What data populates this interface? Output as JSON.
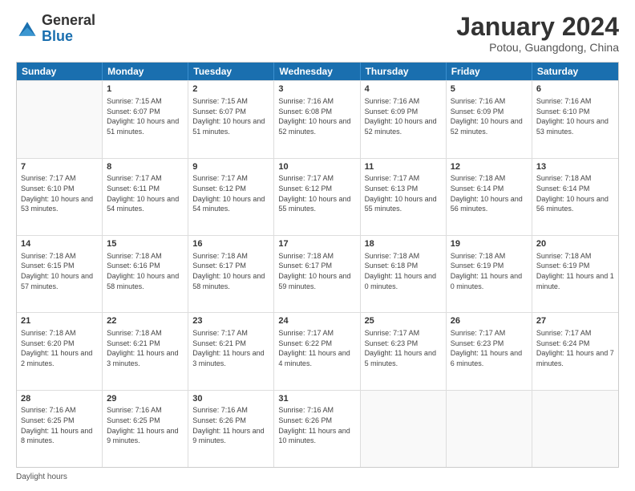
{
  "header": {
    "logo_general": "General",
    "logo_blue": "Blue",
    "month_title": "January 2024",
    "location": "Potou, Guangdong, China"
  },
  "days_of_week": [
    "Sunday",
    "Monday",
    "Tuesday",
    "Wednesday",
    "Thursday",
    "Friday",
    "Saturday"
  ],
  "weeks": [
    [
      {
        "day": "",
        "empty": true
      },
      {
        "day": "1",
        "sunrise": "Sunrise: 7:15 AM",
        "sunset": "Sunset: 6:07 PM",
        "daylight": "Daylight: 10 hours and 51 minutes."
      },
      {
        "day": "2",
        "sunrise": "Sunrise: 7:15 AM",
        "sunset": "Sunset: 6:07 PM",
        "daylight": "Daylight: 10 hours and 51 minutes."
      },
      {
        "day": "3",
        "sunrise": "Sunrise: 7:16 AM",
        "sunset": "Sunset: 6:08 PM",
        "daylight": "Daylight: 10 hours and 52 minutes."
      },
      {
        "day": "4",
        "sunrise": "Sunrise: 7:16 AM",
        "sunset": "Sunset: 6:09 PM",
        "daylight": "Daylight: 10 hours and 52 minutes."
      },
      {
        "day": "5",
        "sunrise": "Sunrise: 7:16 AM",
        "sunset": "Sunset: 6:09 PM",
        "daylight": "Daylight: 10 hours and 52 minutes."
      },
      {
        "day": "6",
        "sunrise": "Sunrise: 7:16 AM",
        "sunset": "Sunset: 6:10 PM",
        "daylight": "Daylight: 10 hours and 53 minutes."
      }
    ],
    [
      {
        "day": "7",
        "sunrise": "Sunrise: 7:17 AM",
        "sunset": "Sunset: 6:10 PM",
        "daylight": "Daylight: 10 hours and 53 minutes."
      },
      {
        "day": "8",
        "sunrise": "Sunrise: 7:17 AM",
        "sunset": "Sunset: 6:11 PM",
        "daylight": "Daylight: 10 hours and 54 minutes."
      },
      {
        "day": "9",
        "sunrise": "Sunrise: 7:17 AM",
        "sunset": "Sunset: 6:12 PM",
        "daylight": "Daylight: 10 hours and 54 minutes."
      },
      {
        "day": "10",
        "sunrise": "Sunrise: 7:17 AM",
        "sunset": "Sunset: 6:12 PM",
        "daylight": "Daylight: 10 hours and 55 minutes."
      },
      {
        "day": "11",
        "sunrise": "Sunrise: 7:17 AM",
        "sunset": "Sunset: 6:13 PM",
        "daylight": "Daylight: 10 hours and 55 minutes."
      },
      {
        "day": "12",
        "sunrise": "Sunrise: 7:18 AM",
        "sunset": "Sunset: 6:14 PM",
        "daylight": "Daylight: 10 hours and 56 minutes."
      },
      {
        "day": "13",
        "sunrise": "Sunrise: 7:18 AM",
        "sunset": "Sunset: 6:14 PM",
        "daylight": "Daylight: 10 hours and 56 minutes."
      }
    ],
    [
      {
        "day": "14",
        "sunrise": "Sunrise: 7:18 AM",
        "sunset": "Sunset: 6:15 PM",
        "daylight": "Daylight: 10 hours and 57 minutes."
      },
      {
        "day": "15",
        "sunrise": "Sunrise: 7:18 AM",
        "sunset": "Sunset: 6:16 PM",
        "daylight": "Daylight: 10 hours and 58 minutes."
      },
      {
        "day": "16",
        "sunrise": "Sunrise: 7:18 AM",
        "sunset": "Sunset: 6:17 PM",
        "daylight": "Daylight: 10 hours and 58 minutes."
      },
      {
        "day": "17",
        "sunrise": "Sunrise: 7:18 AM",
        "sunset": "Sunset: 6:17 PM",
        "daylight": "Daylight: 10 hours and 59 minutes."
      },
      {
        "day": "18",
        "sunrise": "Sunrise: 7:18 AM",
        "sunset": "Sunset: 6:18 PM",
        "daylight": "Daylight: 11 hours and 0 minutes."
      },
      {
        "day": "19",
        "sunrise": "Sunrise: 7:18 AM",
        "sunset": "Sunset: 6:19 PM",
        "daylight": "Daylight: 11 hours and 0 minutes."
      },
      {
        "day": "20",
        "sunrise": "Sunrise: 7:18 AM",
        "sunset": "Sunset: 6:19 PM",
        "daylight": "Daylight: 11 hours and 1 minute."
      }
    ],
    [
      {
        "day": "21",
        "sunrise": "Sunrise: 7:18 AM",
        "sunset": "Sunset: 6:20 PM",
        "daylight": "Daylight: 11 hours and 2 minutes."
      },
      {
        "day": "22",
        "sunrise": "Sunrise: 7:18 AM",
        "sunset": "Sunset: 6:21 PM",
        "daylight": "Daylight: 11 hours and 3 minutes."
      },
      {
        "day": "23",
        "sunrise": "Sunrise: 7:17 AM",
        "sunset": "Sunset: 6:21 PM",
        "daylight": "Daylight: 11 hours and 3 minutes."
      },
      {
        "day": "24",
        "sunrise": "Sunrise: 7:17 AM",
        "sunset": "Sunset: 6:22 PM",
        "daylight": "Daylight: 11 hours and 4 minutes."
      },
      {
        "day": "25",
        "sunrise": "Sunrise: 7:17 AM",
        "sunset": "Sunset: 6:23 PM",
        "daylight": "Daylight: 11 hours and 5 minutes."
      },
      {
        "day": "26",
        "sunrise": "Sunrise: 7:17 AM",
        "sunset": "Sunset: 6:23 PM",
        "daylight": "Daylight: 11 hours and 6 minutes."
      },
      {
        "day": "27",
        "sunrise": "Sunrise: 7:17 AM",
        "sunset": "Sunset: 6:24 PM",
        "daylight": "Daylight: 11 hours and 7 minutes."
      }
    ],
    [
      {
        "day": "28",
        "sunrise": "Sunrise: 7:16 AM",
        "sunset": "Sunset: 6:25 PM",
        "daylight": "Daylight: 11 hours and 8 minutes."
      },
      {
        "day": "29",
        "sunrise": "Sunrise: 7:16 AM",
        "sunset": "Sunset: 6:25 PM",
        "daylight": "Daylight: 11 hours and 9 minutes."
      },
      {
        "day": "30",
        "sunrise": "Sunrise: 7:16 AM",
        "sunset": "Sunset: 6:26 PM",
        "daylight": "Daylight: 11 hours and 9 minutes."
      },
      {
        "day": "31",
        "sunrise": "Sunrise: 7:16 AM",
        "sunset": "Sunset: 6:26 PM",
        "daylight": "Daylight: 11 hours and 10 minutes."
      },
      {
        "day": "",
        "empty": true
      },
      {
        "day": "",
        "empty": true
      },
      {
        "day": "",
        "empty": true
      }
    ]
  ],
  "footer": {
    "daylight_label": "Daylight hours"
  }
}
